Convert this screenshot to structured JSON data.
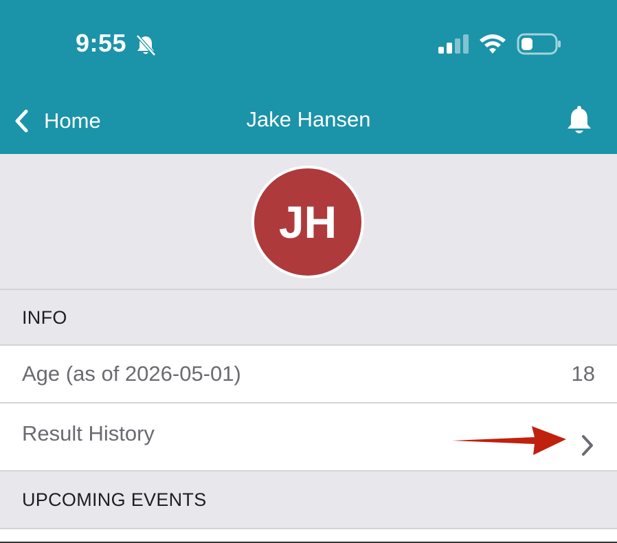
{
  "status_bar": {
    "time": "9:55",
    "icons": [
      "bell-slash-icon",
      "cellular-signal-icon",
      "wifi-icon",
      "battery-icon"
    ]
  },
  "nav": {
    "back_label": "Home",
    "title": "Jake Hansen",
    "right_icon": "bell-icon"
  },
  "profile": {
    "initials": "JH",
    "avatar_color": "#ae3a3c"
  },
  "sections": {
    "info": {
      "header": "INFO",
      "age_label": "Age (as of 2026-05-01)",
      "age_value": "18",
      "result_history_label": "Result History"
    },
    "upcoming": {
      "header": "UPCOMING EVENTS"
    }
  },
  "colors": {
    "header_bg": "#1b93a9",
    "page_bg": "#e8e8ec",
    "annotation_arrow": "#c0200e"
  }
}
